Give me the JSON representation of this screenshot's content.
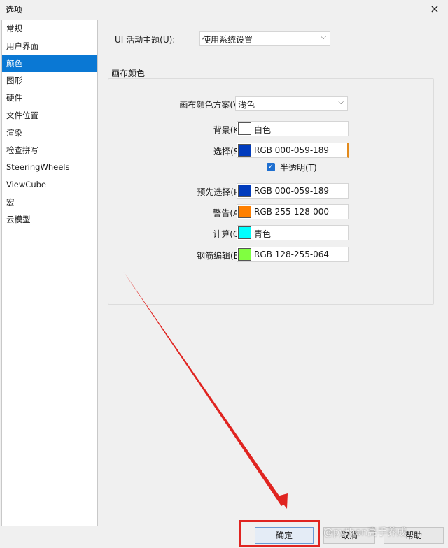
{
  "window": {
    "title": "选项",
    "close_icon": "×"
  },
  "sidebar": {
    "items": [
      {
        "label": "常规"
      },
      {
        "label": "用户界面"
      },
      {
        "label": "颜色",
        "active": true
      },
      {
        "label": "图形"
      },
      {
        "label": "硬件"
      },
      {
        "label": "文件位置"
      },
      {
        "label": "渲染"
      },
      {
        "label": "检查拼写"
      },
      {
        "label": "SteeringWheels"
      },
      {
        "label": "ViewCube"
      },
      {
        "label": "宏"
      },
      {
        "label": "云模型"
      }
    ]
  },
  "main": {
    "theme_label": "UI 活动主题(U):",
    "theme_value": "使用系统设置",
    "group_title": "画布颜色",
    "scheme_label": "画布颜色方案(V):",
    "scheme_value": "浅色",
    "rows": [
      {
        "label": "背景(K):",
        "value": "白色",
        "color": "#ffffff"
      },
      {
        "label": "选择(S):",
        "value": "RGB 000-059-189",
        "color": "#003bbd"
      },
      {
        "label": "预先选择(P):",
        "value": "RGB 000-059-189",
        "color": "#003bbd"
      },
      {
        "label": "警告(A):",
        "value": "RGB 255-128-000",
        "color": "#ff8000"
      },
      {
        "label": "计算(C):",
        "value": "青色",
        "color": "#00ffff"
      },
      {
        "label": "钢筋编辑(E):",
        "value": "RGB 128-255-064",
        "color": "#80ff40"
      }
    ],
    "translucent_label": "半透明(T)",
    "translucent_checked": true
  },
  "footer": {
    "ok_label": "确定",
    "cancel_label": "取消",
    "help_label": "帮助"
  },
  "annotation": {
    "color": "#e02420"
  },
  "watermark": {
    "text": "@python高手养成"
  }
}
